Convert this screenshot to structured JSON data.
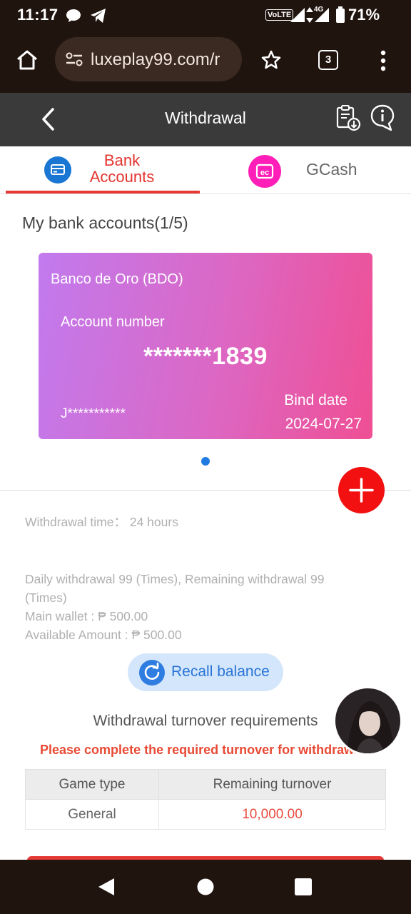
{
  "status_bar": {
    "time": "11:17",
    "network": "VoLTE",
    "network_gen": "4G",
    "battery": "71%"
  },
  "browser": {
    "url": "luxeplay99.com/r",
    "tab_count": "3"
  },
  "header": {
    "title": "Withdrawal"
  },
  "tabs": [
    {
      "label": "Bank Accounts",
      "active": true
    },
    {
      "label": "GCash",
      "active": false
    }
  ],
  "accounts": {
    "title": "My bank accounts(1/5)",
    "card": {
      "bank_name": "Banco de Oro (BDO)",
      "account_label": "Account number",
      "account_number": "*******1839",
      "holder": "J***********",
      "bind_label": "Bind date",
      "bind_date": "2024-07-27"
    }
  },
  "info": {
    "withdrawal_time": "Withdrawal time： 24 hours",
    "daily": "Daily withdrawal 99 (Times), Remaining withdrawal 99 (Times)",
    "main_wallet": "Main wallet : ₱ 500.00",
    "available": "Available Amount : ₱ 500.00"
  },
  "recall_button": {
    "label": "Recall balance"
  },
  "turnover": {
    "title": "Withdrawal turnover requirements",
    "warning": "Please complete the required turnover for withdrawal",
    "columns": [
      "Game type",
      "Remaining turnover"
    ],
    "rows": [
      {
        "game_type": "General",
        "remaining": "10,000.00"
      }
    ]
  },
  "colors": {
    "accent_red": "#e53935",
    "card_start": "#c17aee",
    "card_end": "#ef4f94",
    "link_blue": "#2a74d6"
  }
}
